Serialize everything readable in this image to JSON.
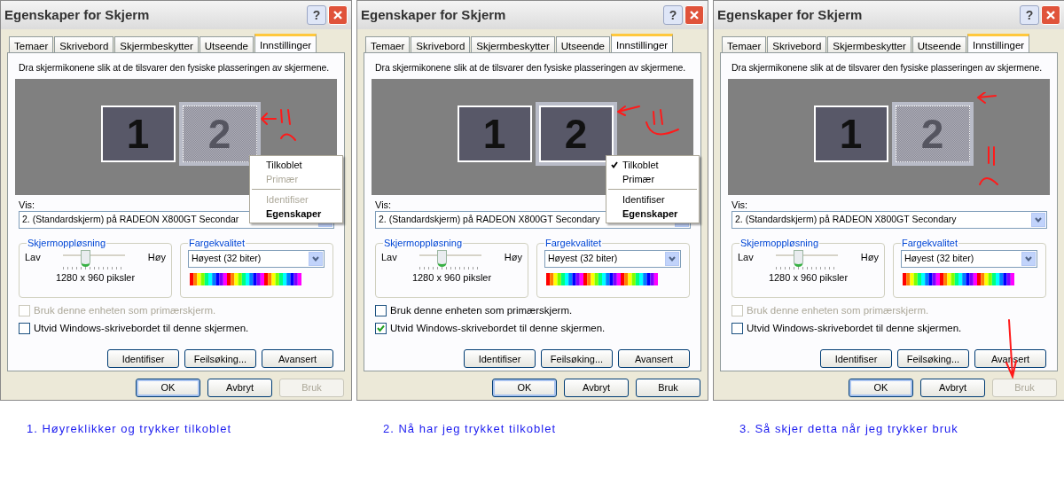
{
  "panels": [
    {
      "window_title": "Egenskaper for Skjerm",
      "help_button": "?",
      "tabs": [
        {
          "label": "Temaer",
          "selected": false
        },
        {
          "label": "Skrivebord",
          "selected": false
        },
        {
          "label": "Skjermbeskytter",
          "selected": false
        },
        {
          "label": "Utseende",
          "selected": false
        },
        {
          "label": "Innstillinger",
          "selected": true
        }
      ],
      "instruction": "Dra skjermikonene slik at de tilsvarer den fysiske plasseringen av skjermene.",
      "monitors": [
        {
          "label": "1",
          "attached": true,
          "selected": false
        },
        {
          "label": "2",
          "attached": false,
          "selected": true
        }
      ],
      "context_menu": [
        {
          "label": "Tilkoblet",
          "checked": false,
          "disabled": false,
          "bold": false
        },
        {
          "label": "Primær",
          "checked": false,
          "disabled": true,
          "bold": false
        },
        {
          "kind": "separator"
        },
        {
          "label": "Identifiser",
          "checked": false,
          "disabled": true,
          "bold": false
        },
        {
          "label": "Egenskaper",
          "checked": false,
          "disabled": false,
          "bold": true
        }
      ],
      "annotation": {
        "kind": "sad"
      },
      "display_label": "Vis:",
      "display_value": "2. (Standardskjerm) på RADEON X800GT Secondar",
      "resolution": {
        "title": "Skjermoppløsning",
        "low": "Lav",
        "high": "Høy",
        "level": 0.35,
        "value": "1280 x 960 piksler"
      },
      "color_quality": {
        "title": "Fargekvalitet",
        "value": "Høyest (32 biter)"
      },
      "checkboxes": [
        {
          "label": "Bruk denne enheten som primærskjerm.",
          "checked": false,
          "disabled": true
        },
        {
          "label": "Utvid Windows-skrivebordet til denne skjermen.",
          "checked": false,
          "disabled": false
        }
      ],
      "buttons": [
        {
          "label": "Identifiser",
          "disabled": false
        },
        {
          "label": "Feilsøking...",
          "disabled": false
        },
        {
          "label": "Avansert",
          "disabled": false
        }
      ],
      "dialog_buttons": [
        {
          "label": "OK",
          "disabled": false,
          "default": true
        },
        {
          "label": "Avbryt",
          "disabled": false,
          "default": false
        },
        {
          "label": "Bruk",
          "disabled": true,
          "default": false
        }
      ],
      "caption": "1. Høyreklikker og trykker tilkoblet"
    },
    {
      "window_title": "Egenskaper for Skjerm",
      "help_button": "?",
      "tabs": [
        {
          "label": "Temaer",
          "selected": false
        },
        {
          "label": "Skrivebord",
          "selected": false
        },
        {
          "label": "Skjermbeskytter",
          "selected": false
        },
        {
          "label": "Utseende",
          "selected": false
        },
        {
          "label": "Innstillinger",
          "selected": true
        }
      ],
      "instruction": "Dra skjermikonene slik at de tilsvarer den fysiske plasseringen av skjermene.",
      "monitors": [
        {
          "label": "1",
          "attached": true,
          "selected": false
        },
        {
          "label": "2",
          "attached": true,
          "selected": true
        }
      ],
      "context_menu": [
        {
          "label": "Tilkoblet",
          "checked": true,
          "disabled": false,
          "bold": false
        },
        {
          "label": "Primær",
          "checked": false,
          "disabled": false,
          "bold": false
        },
        {
          "kind": "separator"
        },
        {
          "label": "Identifiser",
          "checked": false,
          "disabled": false,
          "bold": false
        },
        {
          "label": "Egenskaper",
          "checked": false,
          "disabled": false,
          "bold": true
        }
      ],
      "annotation": {
        "kind": "happy"
      },
      "display_label": "Vis:",
      "display_value": "2. (Standardskjerm) på RADEON X800GT Secondary",
      "resolution": {
        "title": "Skjermoppløsning",
        "low": "Lav",
        "high": "Høy",
        "level": 0.35,
        "value": "1280 x 960 piksler"
      },
      "color_quality": {
        "title": "Fargekvalitet",
        "value": "Høyest (32 biter)"
      },
      "checkboxes": [
        {
          "label": "Bruk denne enheten som primærskjerm.",
          "checked": false,
          "disabled": false
        },
        {
          "label": "Utvid Windows-skrivebordet til denne skjermen.",
          "checked": true,
          "disabled": false
        }
      ],
      "buttons": [
        {
          "label": "Identifiser",
          "disabled": false
        },
        {
          "label": "Feilsøking...",
          "disabled": false
        },
        {
          "label": "Avansert",
          "disabled": false
        }
      ],
      "dialog_buttons": [
        {
          "label": "OK",
          "disabled": false,
          "default": true
        },
        {
          "label": "Avbryt",
          "disabled": false,
          "default": false
        },
        {
          "label": "Bruk",
          "disabled": false,
          "default": false
        }
      ],
      "caption": "2. Nå har jeg trykket tilkoblet"
    },
    {
      "window_title": "Egenskaper for Skjerm",
      "help_button": "?",
      "tabs": [
        {
          "label": "Temaer",
          "selected": false
        },
        {
          "label": "Skrivebord",
          "selected": false
        },
        {
          "label": "Skjermbeskytter",
          "selected": false
        },
        {
          "label": "Utseende",
          "selected": false
        },
        {
          "label": "Innstillinger",
          "selected": true
        }
      ],
      "instruction": "Dra skjermikonene slik at de tilsvarer den fysiske plasseringen av skjermene.",
      "monitors": [
        {
          "label": "1",
          "attached": true,
          "selected": false
        },
        {
          "label": "2",
          "attached": false,
          "selected": true
        }
      ],
      "annotation": {
        "kind": "sad_arrow"
      },
      "display_label": "Vis:",
      "display_value": "2. (Standardskjerm) på RADEON X800GT Secondary",
      "resolution": {
        "title": "Skjermoppløsning",
        "low": "Lav",
        "high": "Høy",
        "level": 0.35,
        "value": "1280 x 960 piksler"
      },
      "color_quality": {
        "title": "Fargekvalitet",
        "value": "Høyest (32 biter)"
      },
      "checkboxes": [
        {
          "label": "Bruk denne enheten som primærskjerm.",
          "checked": false,
          "disabled": true
        },
        {
          "label": "Utvid Windows-skrivebordet til denne skjermen.",
          "checked": false,
          "disabled": false
        }
      ],
      "buttons": [
        {
          "label": "Identifiser",
          "disabled": false
        },
        {
          "label": "Feilsøking...",
          "disabled": false
        },
        {
          "label": "Avansert",
          "disabled": false
        }
      ],
      "dialog_buttons": [
        {
          "label": "OK",
          "disabled": false,
          "default": true
        },
        {
          "label": "Avbryt",
          "disabled": false,
          "default": false
        },
        {
          "label": "Bruk",
          "disabled": true,
          "default": false
        }
      ],
      "caption": "3. Så skjer detta når jeg trykker bruk"
    }
  ]
}
